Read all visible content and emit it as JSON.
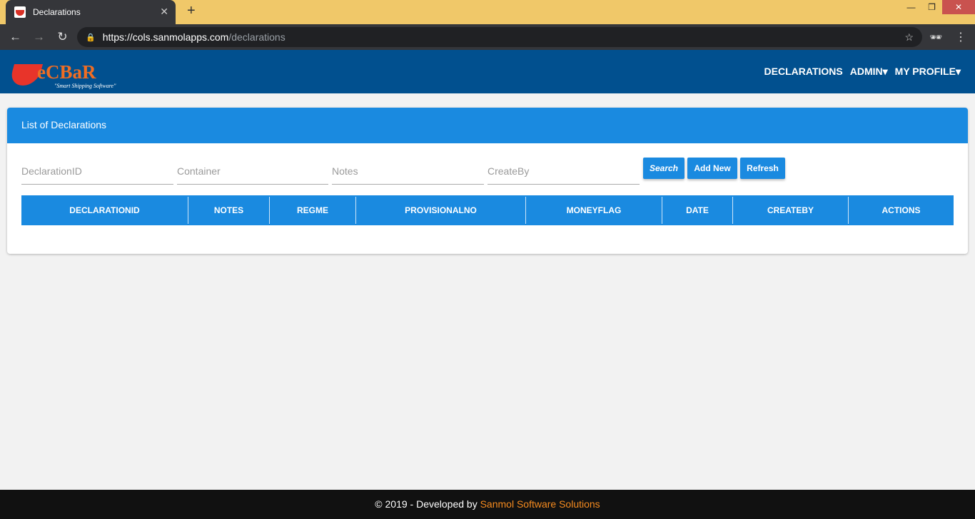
{
  "browser": {
    "tab_title": "Declarations",
    "url_host": "https://cols.sanmolapps.com",
    "url_path": "/declarations"
  },
  "header": {
    "logo_text": "eCBaR",
    "logo_tagline": "\"Smart Shipping Software\"",
    "nav": [
      {
        "label": "DECLARATIONS"
      },
      {
        "label": "ADMIN▾"
      },
      {
        "label": "MY PROFILE▾"
      }
    ]
  },
  "card": {
    "title": "List of Declarations",
    "filters": [
      {
        "placeholder": "DeclarationID"
      },
      {
        "placeholder": "Container"
      },
      {
        "placeholder": "Notes"
      },
      {
        "placeholder": "CreateBy"
      }
    ],
    "buttons": {
      "search": "Search",
      "add_new": "Add New",
      "refresh": "Refresh"
    },
    "columns": [
      "DECLARATIONID",
      "NOTES",
      "REGME",
      "PROVISIONALNO",
      "MONEYFLAG",
      "DATE",
      "CREATEBY",
      "ACTIONS"
    ],
    "rows": []
  },
  "footer": {
    "prefix": "© 2019 - Developed by ",
    "link": "Sanmol Software Solutions"
  },
  "colors": {
    "header": "#01508f",
    "accent": "#1a8ae0",
    "footer_link": "#f68b1f"
  }
}
